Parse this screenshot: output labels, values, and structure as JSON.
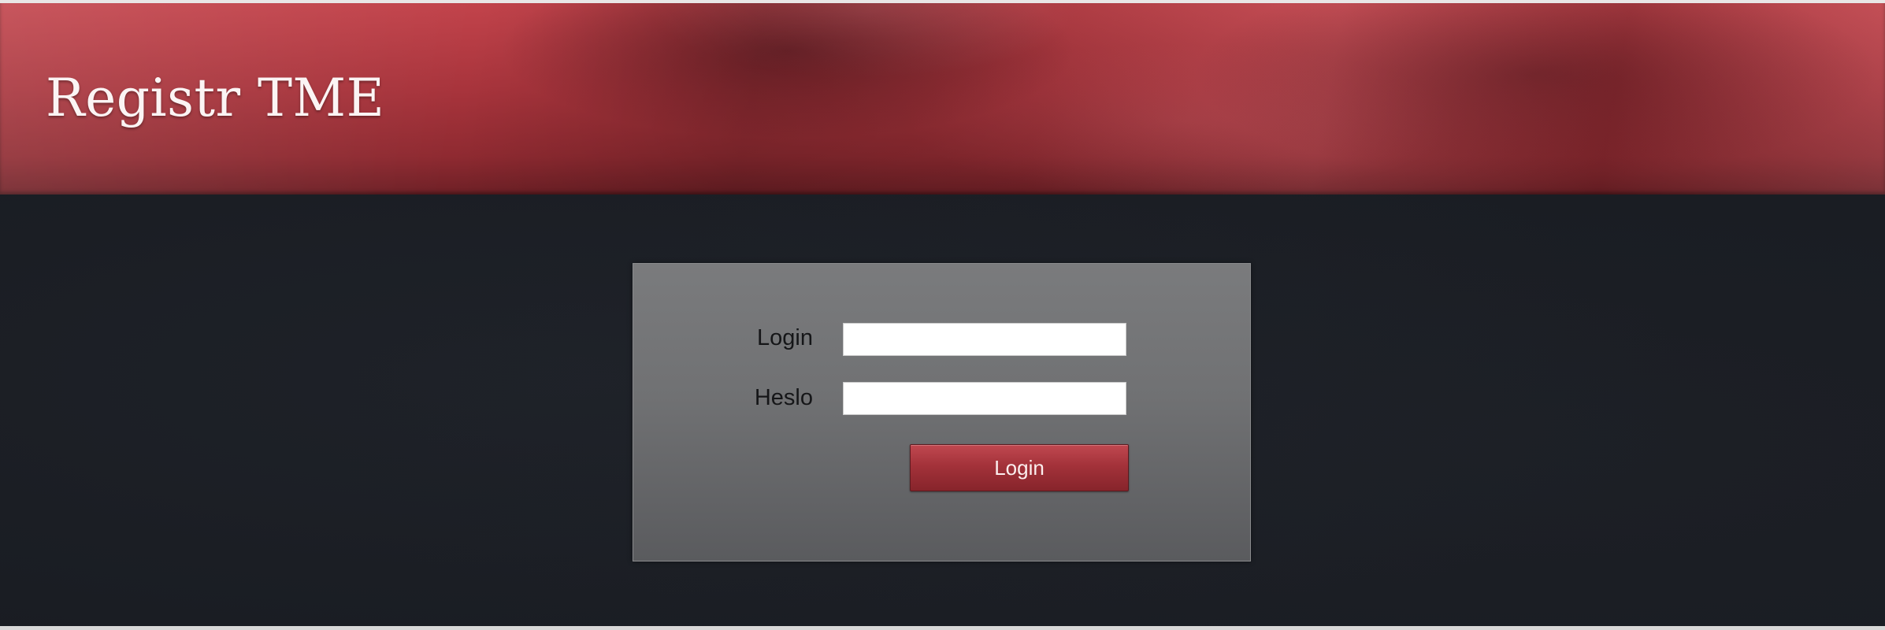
{
  "header": {
    "title": "Registr TME"
  },
  "login_form": {
    "login_label": "Login",
    "login_value": "",
    "password_label": "Heslo",
    "password_value": "",
    "submit_label": "Login"
  },
  "colors": {
    "header_red": "#a8343c",
    "background": "#191c22",
    "panel_gray": "#707173",
    "button_red": "#a3323a"
  }
}
